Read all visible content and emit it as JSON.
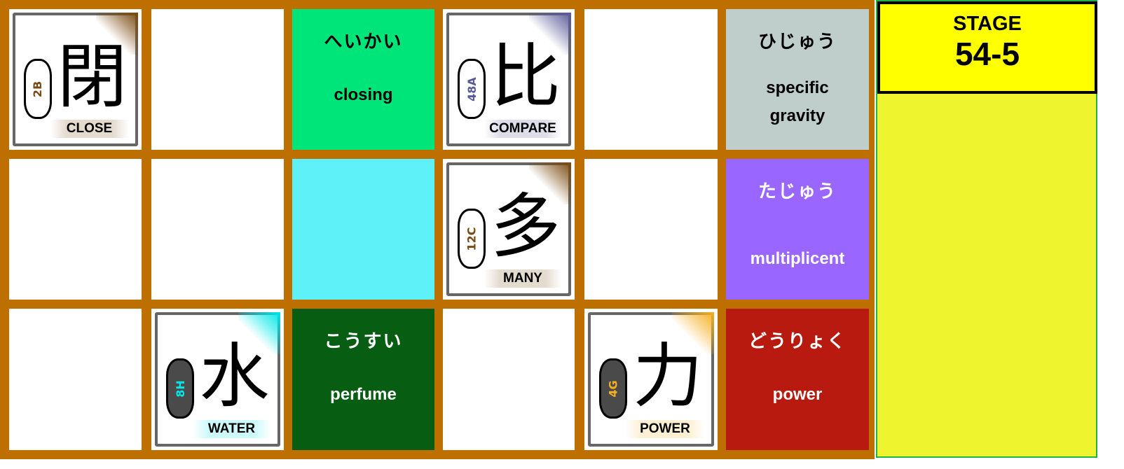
{
  "colors": {
    "board": "#BD7000",
    "side_panel": "#EEF52E",
    "stage_box": "#FFFF00"
  },
  "stage": {
    "label": "STAGE",
    "number": "54-5"
  },
  "cards": [
    {
      "kanji": "閉",
      "code": "2B",
      "meaning": "CLOSE",
      "accent": "#7A4A10",
      "cloud": "light"
    },
    {
      "kanji": "比",
      "code": "48A",
      "meaning": "COMPARE",
      "accent": "#5A5A9A",
      "cloud": "light"
    },
    {
      "kanji": "多",
      "code": "12C",
      "meaning": "MANY",
      "accent": "#7A4A10",
      "cloud": "light"
    },
    {
      "kanji": "水",
      "code": "8H",
      "meaning": "WATER",
      "accent": "#00E8E8",
      "cloud": "dark"
    },
    {
      "kanji": "力",
      "code": "4G",
      "meaning": "POWER",
      "accent": "#F5B020",
      "cloud": "dark"
    }
  ],
  "words": [
    {
      "kana": "へいかい",
      "english": "closing",
      "bg": "#00E57A",
      "fg": "#000000"
    },
    {
      "kana": "ひじゅう",
      "english": "specific gravity",
      "bg": "#BFCDCB",
      "fg": "#000000"
    },
    {
      "kana": "たじゅう",
      "english": "multiplicent",
      "bg": "#9966FF",
      "fg": "#FFFFFF"
    },
    {
      "kana": "こうすい",
      "english": "perfume",
      "bg": "#075E12",
      "fg": "#FFFFFF"
    },
    {
      "kana": "どうりょく",
      "english": "power",
      "bg": "#B81A10",
      "fg": "#FFFFFF"
    }
  ],
  "blank_tiles": [
    {
      "color": "#5EF2F8"
    }
  ]
}
